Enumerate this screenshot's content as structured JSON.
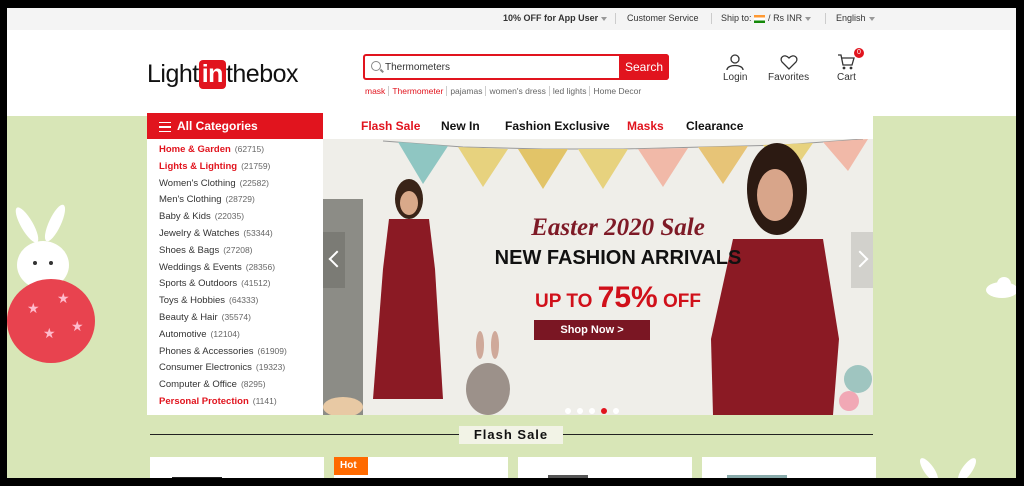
{
  "topbar": {
    "promo": "10% OFF for App User",
    "service": "Customer Service",
    "ship_label": "Ship to:",
    "currency": "Rs INR",
    "language": "English"
  },
  "header": {
    "logo": {
      "pre": "Light",
      "in": "in",
      "post": "thebox"
    },
    "search": {
      "value": "Thermometers",
      "button": "Search"
    },
    "hotwords": [
      "mask",
      "Thermometer",
      "pajamas",
      "women's dress",
      "led lights",
      "Home Decor"
    ],
    "login": "Login",
    "favorites": "Favorites",
    "cart": "Cart",
    "cart_count": "0"
  },
  "nav": {
    "all_categories": "All Categories",
    "items": [
      {
        "label": "Flash Sale",
        "red": true
      },
      {
        "label": "New In",
        "red": false
      },
      {
        "label": "Fashion Exclusive",
        "red": false
      },
      {
        "label": "Masks",
        "red": true
      },
      {
        "label": "Clearance",
        "red": false
      }
    ]
  },
  "categories": [
    {
      "label": "Home & Garden",
      "count": "(62715)",
      "red": true
    },
    {
      "label": "Lights & Lighting",
      "count": "(21759)",
      "red": true
    },
    {
      "label": "Women's Clothing",
      "count": "(22582)",
      "red": false
    },
    {
      "label": "Men's Clothing",
      "count": "(28729)",
      "red": false
    },
    {
      "label": "Baby & Kids",
      "count": "(22035)",
      "red": false
    },
    {
      "label": "Jewelry & Watches",
      "count": "(53344)",
      "red": false
    },
    {
      "label": "Shoes & Bags",
      "count": "(27208)",
      "red": false
    },
    {
      "label": "Weddings & Events",
      "count": "(28356)",
      "red": false
    },
    {
      "label": "Sports & Outdoors",
      "count": "(41512)",
      "red": false
    },
    {
      "label": "Toys & Hobbies",
      "count": "(64333)",
      "red": false
    },
    {
      "label": "Beauty & Hair",
      "count": "(35574)",
      "red": false
    },
    {
      "label": "Automotive",
      "count": "(12104)",
      "red": false
    },
    {
      "label": "Phones & Accessories",
      "count": "(61909)",
      "red": false
    },
    {
      "label": "Consumer Electronics",
      "count": "(19323)",
      "red": false
    },
    {
      "label": "Computer & Office",
      "count": "(8295)",
      "red": false
    },
    {
      "label": "Personal Protection",
      "count": "(1141)",
      "red": true
    }
  ],
  "banner": {
    "title": "Easter 2020 Sale",
    "subtitle": "NEW FASHION ARRIVALS",
    "offer_pre": "UP TO",
    "offer_big": "75%",
    "offer_post": "OFF",
    "cta": "Shop Now >",
    "slides": 5,
    "active_slide": 4
  },
  "flash_sale": {
    "title": "Flash Sale",
    "hot_badge": "Hot"
  },
  "colors": {
    "brand": "#e1141e",
    "banner_accent": "#7a1623",
    "page_bg": "#d8e6b7"
  }
}
